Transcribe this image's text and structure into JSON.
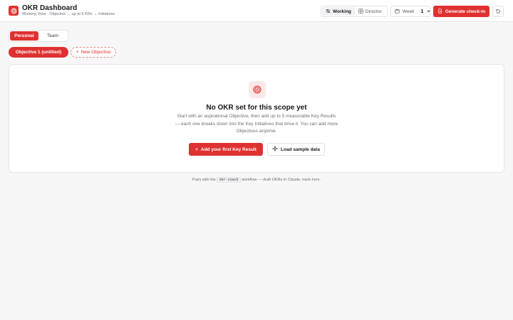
{
  "header": {
    "title": "OKR Dashboard",
    "subtitle": "Working View · Objective → up to 5 KRs → Initiatives",
    "view_toggle": [
      {
        "label": "Working",
        "icon": "sliders-icon",
        "active": true
      },
      {
        "label": "Director",
        "icon": "grid-icon",
        "active": false
      }
    ],
    "week": {
      "label": "Week",
      "value": "1"
    },
    "checkin_label": "Generate check-in",
    "accent": "#e03131"
  },
  "scope_tabs": [
    {
      "label": "Personal",
      "active": true
    },
    {
      "label": "Team",
      "active": false
    }
  ],
  "objectives": {
    "current": "Objective 1 (untitled)",
    "new_label": "New Objective"
  },
  "empty_state": {
    "title": "No OKR set for this scope yet",
    "description": "Start with an aspirational Objective, then add up to 5 measurable Key Results — each one breaks down into the Key Initiatives that drive it. You can add more Objectives anytime.",
    "primary_label": "Add your first Key Result",
    "secondary_label": "Load sample data"
  },
  "footer": {
    "prefix": "Pairs with the",
    "code": "okr-coach",
    "suffix": "workflow — draft OKRs in Claude, track here."
  }
}
